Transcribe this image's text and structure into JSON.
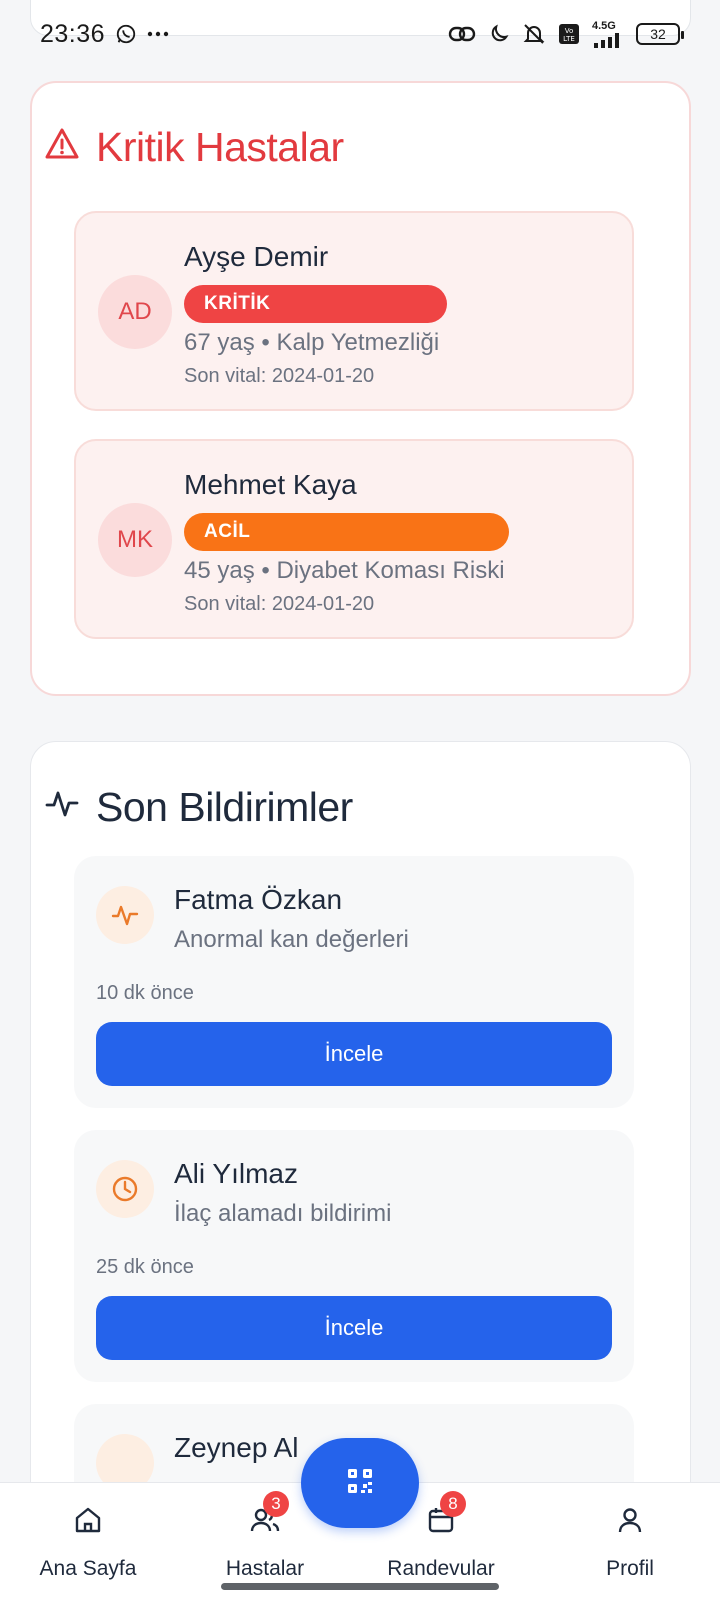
{
  "status_bar": {
    "time": "23:36",
    "network": "4.5G",
    "volte": "Vo LTE",
    "battery": "32"
  },
  "critical_section": {
    "title": "Kritik Hastalar",
    "patients": [
      {
        "initials": "AD",
        "name": "Ayşe Demir",
        "status": "KRİTİK",
        "info": "67 yaş • Kalp Yetmezliği",
        "vital": "Son vital: 2024-01-20"
      },
      {
        "initials": "MK",
        "name": "Mehmet Kaya",
        "status": "ACİL",
        "info": "45 yaş • Diyabet Koması Riski",
        "vital": "Son vital: 2024-01-20"
      }
    ]
  },
  "notifications_section": {
    "title": "Son Bildirimler",
    "items": [
      {
        "icon": "activity-icon",
        "name": "Fatma Özkan",
        "description": "Anormal kan değerleri",
        "time": "10 dk önce",
        "button": "İncele"
      },
      {
        "icon": "clock-icon",
        "name": "Ali Yılmaz",
        "description": "İlaç alamadı bildirimi",
        "time": "25 dk önce",
        "button": "İncele"
      },
      {
        "name": "Zeynep Al"
      }
    ]
  },
  "bottom_nav": {
    "items": [
      {
        "label": "Ana Sayfa",
        "icon": "home-icon"
      },
      {
        "label": "Hastalar",
        "icon": "users-icon",
        "badge": "3"
      },
      {
        "label": "Randevular",
        "icon": "calendar-icon",
        "badge": "8"
      },
      {
        "label": "Profil",
        "icon": "user-icon"
      }
    ],
    "fab_icon": "qr-code-icon"
  },
  "colors": {
    "critical": "#ef4444",
    "urgent": "#f97316",
    "primary": "#2563eb",
    "title_red": "#e23a3f"
  }
}
